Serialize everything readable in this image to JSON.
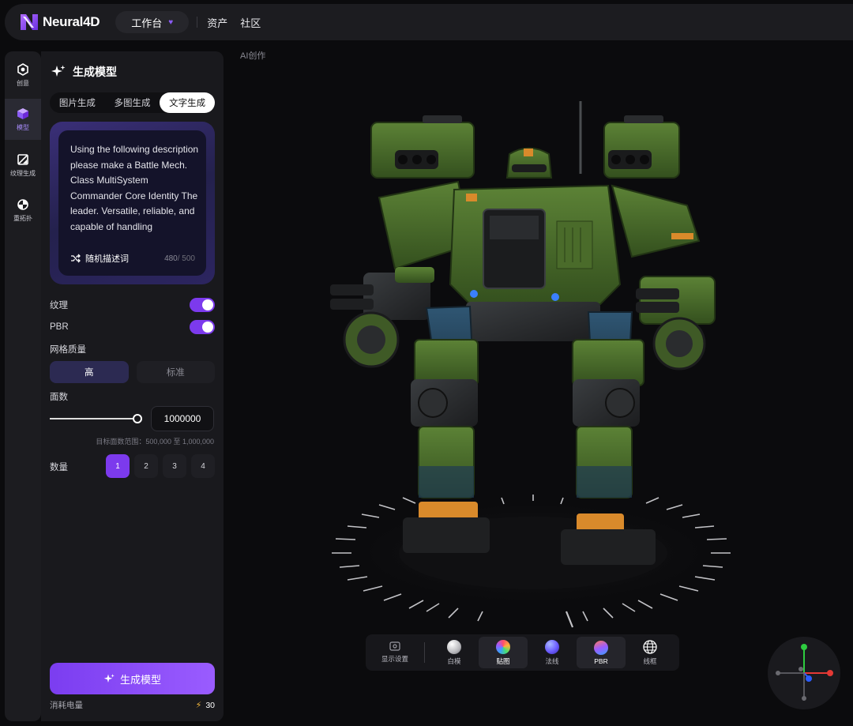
{
  "topbar": {
    "brand": "Neural4D",
    "workspace_label": "工作台",
    "nav": [
      "资产",
      "社区"
    ]
  },
  "rail": {
    "items": [
      {
        "label": "创意",
        "icon": "creative-icon"
      },
      {
        "label": "模型",
        "icon": "cube-icon",
        "active": true
      },
      {
        "label": "纹理生成",
        "icon": "texture-icon"
      },
      {
        "label": "重拓扑",
        "icon": "retopology-icon"
      }
    ]
  },
  "panel": {
    "title": "生成模型",
    "tabs": [
      {
        "label": "图片生成"
      },
      {
        "label": "多图生成"
      },
      {
        "label": "文字生成",
        "active": true
      }
    ],
    "prompt": {
      "text": "Using the following description please make a Battle Mech. Class MultiSystem Commander Core Identity The leader. Versatile, reliable, and capable of handling",
      "random_label": "随机描述词",
      "count": "480",
      "max": "/ 500"
    },
    "texture_label": "纹理",
    "texture_on": true,
    "pbr_label": "PBR",
    "pbr_on": true,
    "mesh_quality_label": "网格质量",
    "mesh_quality_options": [
      "高",
      "标准"
    ],
    "mesh_quality_selected": "高",
    "faces_label": "面数",
    "faces_value": "1000000",
    "faces_slider_fraction": 1.0,
    "faces_range_hint": "目标面数范围：500,000 至 1,000,000",
    "quantity_label": "数量",
    "quantity_options": [
      "1",
      "2",
      "3",
      "4"
    ],
    "quantity_selected": "1",
    "generate_label": "生成模型",
    "cost_label": "消耗电量",
    "cost_value": "30"
  },
  "viewport": {
    "label": "AI创作",
    "display_modes": [
      {
        "label": "显示设置",
        "icon": "display-settings-icon"
      },
      {
        "label": "白模",
        "icon": "white-ball-icon"
      },
      {
        "label": "贴图",
        "icon": "texture-ball-icon",
        "active": true
      },
      {
        "label": "法线",
        "icon": "normal-ball-icon"
      },
      {
        "label": "PBR",
        "icon": "pbr-ball-icon",
        "active": true
      },
      {
        "label": "线框",
        "icon": "wireframe-icon"
      }
    ]
  },
  "colors": {
    "accent": "#7c3aed",
    "panel_bg": "#19191d",
    "page_bg": "#0b0b0d",
    "mech_green": "#4a6b2a",
    "mech_orange": "#d98a2b"
  }
}
